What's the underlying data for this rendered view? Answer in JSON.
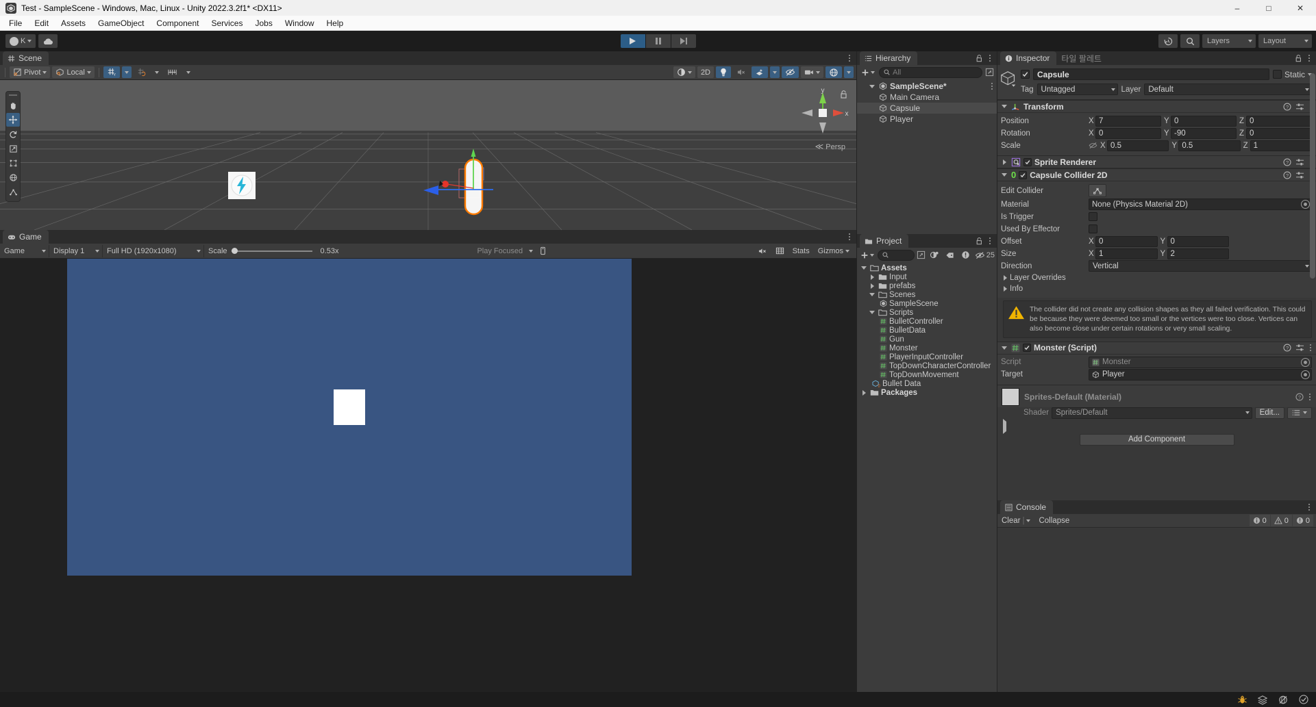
{
  "window": {
    "title": "Test - SampleScene - Windows, Mac, Linux - Unity 2022.3.2f1* <DX11>",
    "minimize": "–",
    "maximize": "□",
    "close": "✕"
  },
  "menubar": {
    "items": [
      "File",
      "Edit",
      "Assets",
      "GameObject",
      "Component",
      "Services",
      "Jobs",
      "Window",
      "Help"
    ]
  },
  "toolbar": {
    "account_label": "K",
    "cloud_label": "",
    "play": "▶",
    "pause": "‖",
    "step": "▶|",
    "layers_label": "Layers",
    "layout_label": "Layout"
  },
  "scene": {
    "tab_label": "Scene",
    "pivot_label": "Pivot",
    "handle_label": "Local",
    "persp_label": "Persp",
    "gizmo_axes": {
      "y": "y",
      "x": "x"
    },
    "tools": [
      "hand-tool",
      "move-tool",
      "rotate-tool",
      "scale-tool",
      "rect-tool",
      "transform-tool",
      "custom-tool"
    ],
    "toggle_2d": "2D"
  },
  "game": {
    "tab_label": "Game",
    "view_select": "Game",
    "display": "Display 1",
    "resolution": "Full HD (1920x1080)",
    "scale_label": "Scale",
    "scale_value": "0.53x",
    "play_mode": "Play Focused",
    "stats_label": "Stats",
    "gizmos_label": "Gizmos"
  },
  "hierarchy": {
    "tab_label": "Hierarchy",
    "search_placeholder": "All",
    "items": [
      {
        "label": "SampleScene*",
        "depth": 0,
        "type": "scene",
        "expanded": true,
        "selected": false
      },
      {
        "label": "Main Camera",
        "depth": 1,
        "type": "object",
        "selected": false
      },
      {
        "label": "Capsule",
        "depth": 1,
        "type": "object",
        "selected": true
      },
      {
        "label": "Player",
        "depth": 1,
        "type": "object",
        "selected": false
      }
    ]
  },
  "project": {
    "tab_label": "Project",
    "search_placeholder": "",
    "hidden_count": "25",
    "items": [
      {
        "label": "Assets",
        "depth": 0,
        "type": "folder-open",
        "expanded": true,
        "bold": true
      },
      {
        "label": "Input",
        "depth": 1,
        "type": "folder",
        "expanded": false
      },
      {
        "label": "prefabs",
        "depth": 1,
        "type": "folder",
        "expanded": false
      },
      {
        "label": "Scenes",
        "depth": 1,
        "type": "folder-open",
        "expanded": true
      },
      {
        "label": "SampleScene",
        "depth": 2,
        "type": "scene"
      },
      {
        "label": "Scripts",
        "depth": 1,
        "type": "folder-open",
        "expanded": true
      },
      {
        "label": "BulletController",
        "depth": 2,
        "type": "script"
      },
      {
        "label": "BulletData",
        "depth": 2,
        "type": "script"
      },
      {
        "label": "Gun",
        "depth": 2,
        "type": "script"
      },
      {
        "label": "Monster",
        "depth": 2,
        "type": "script"
      },
      {
        "label": "PlayerInputController",
        "depth": 2,
        "type": "script"
      },
      {
        "label": "TopDownCharacterController",
        "depth": 2,
        "type": "script"
      },
      {
        "label": "TopDownMovement",
        "depth": 2,
        "type": "script"
      },
      {
        "label": "Bullet Data",
        "depth": 1,
        "type": "asset"
      },
      {
        "label": "Packages",
        "depth": 0,
        "type": "folder",
        "expanded": false,
        "bold": true
      }
    ]
  },
  "inspector": {
    "tab_label": "Inspector",
    "tab2_label": "타일 팔레트",
    "object_name": "Capsule",
    "static_label": "Static",
    "tag_label": "Tag",
    "tag_value": "Untagged",
    "layer_label": "Layer",
    "layer_value": "Default",
    "transform": {
      "title": "Transform",
      "position_label": "Position",
      "rotation_label": "Rotation",
      "scale_label": "Scale",
      "axis_x": "X",
      "axis_y": "Y",
      "axis_z": "Z",
      "position": {
        "x": "7",
        "y": "0",
        "z": "0"
      },
      "rotation": {
        "x": "0",
        "y": "-90",
        "z": "0"
      },
      "scale": {
        "x": "0.5",
        "y": "0.5",
        "z": "1"
      }
    },
    "sprite_renderer": {
      "title": "Sprite Renderer"
    },
    "collider": {
      "title": "Capsule Collider 2D",
      "badge": "0",
      "edit_collider_label": "Edit Collider",
      "material_label": "Material",
      "material_value": "None (Physics Material 2D)",
      "is_trigger_label": "Is Trigger",
      "used_by_effector_label": "Used By Effector",
      "offset_label": "Offset",
      "offset": {
        "x": "0",
        "y": "0"
      },
      "size_label": "Size",
      "size": {
        "x": "1",
        "y": "2"
      },
      "direction_label": "Direction",
      "direction_value": "Vertical",
      "layer_overrides_label": "Layer Overrides",
      "info_label": "Info",
      "warning": "The collider did not create any collision shapes as they all failed verification.  This could be because they were deemed too small or the vertices were too close.  Vertices can also become close under certain rotations or very small scaling."
    },
    "monster_script": {
      "title": "Monster (Script)",
      "script_label": "Script",
      "script_value": "Monster",
      "target_label": "Target",
      "target_value": "Player"
    },
    "material": {
      "title": "Sprites-Default (Material)",
      "shader_label": "Shader",
      "shader_value": "Sprites/Default",
      "edit_label": "Edit..."
    },
    "add_component_label": "Add Component"
  },
  "console": {
    "tab_label": "Console",
    "clear_label": "Clear",
    "collapse_label": "Collapse",
    "log_count": "0",
    "warning_count": "0",
    "error_count": "0"
  },
  "colors": {
    "accent_blue": "#3a5f82",
    "game_bg": "#395582",
    "collider_outline": "#ff7b00",
    "warning_yellow": "#f0b400",
    "script_green": "#62b562"
  }
}
